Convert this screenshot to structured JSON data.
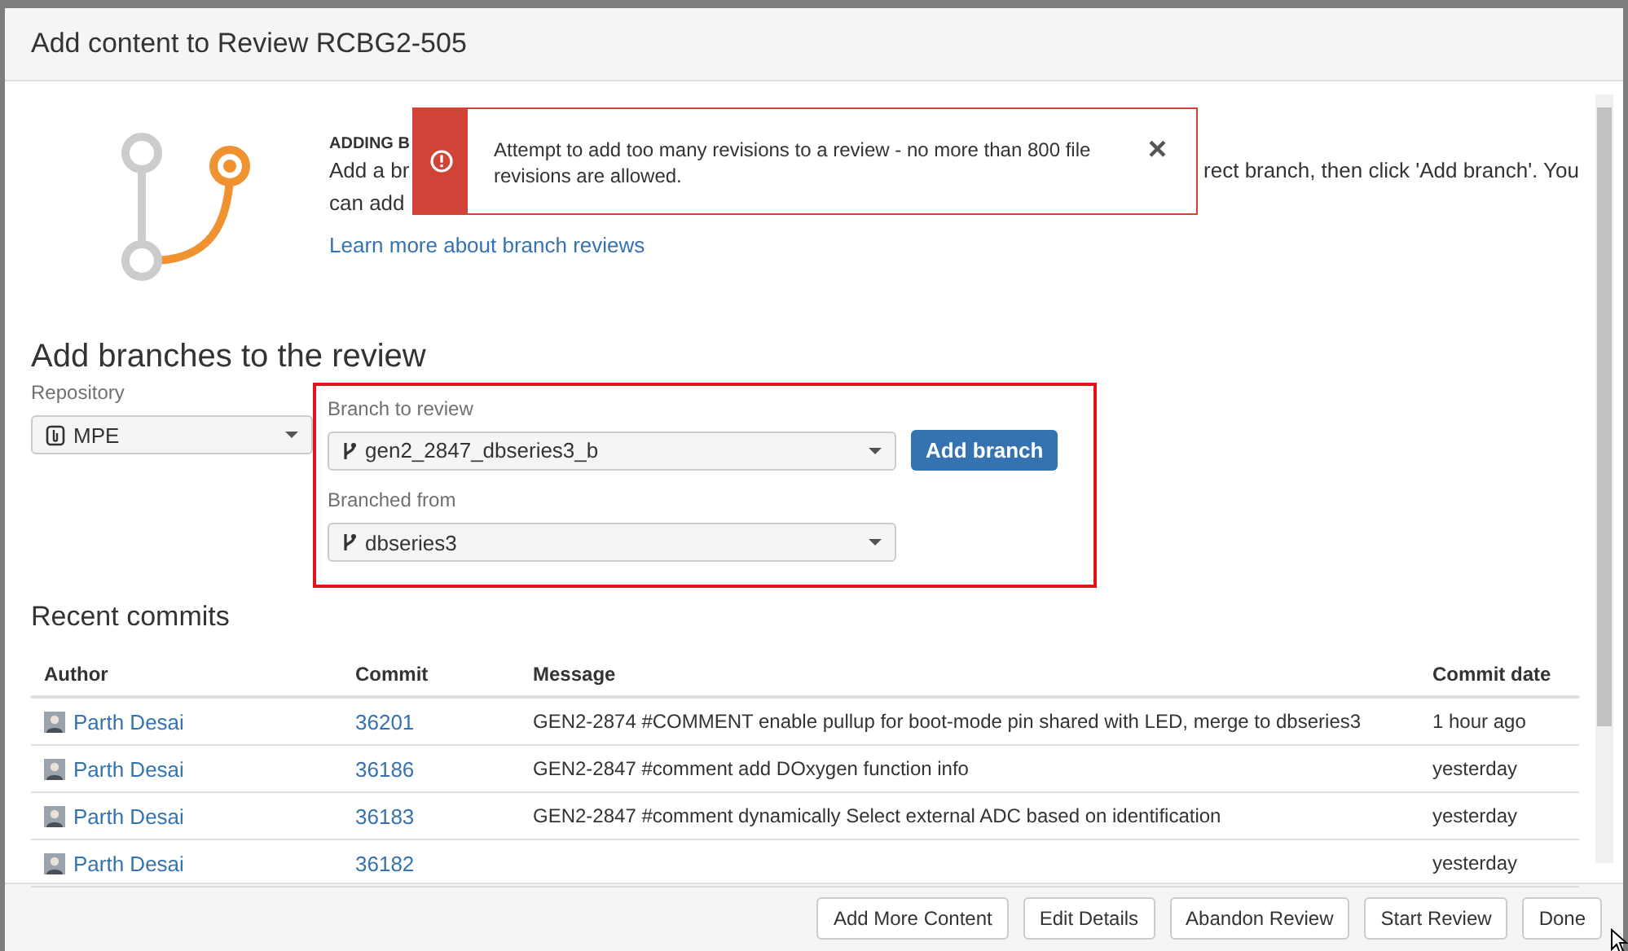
{
  "dialog": {
    "title": "Add content to Review RCBG2-505"
  },
  "intro": {
    "heading": "ADDING B",
    "line_1_start": "Add a br",
    "line_1_end": "rect branch, then click 'Add branch'. You",
    "line_2": "can add",
    "link": "Learn more about branch reviews"
  },
  "alert": {
    "message": "Attempt to add too many revisions to a review - no more than 800 file revisions are allowed.",
    "close": "×"
  },
  "form": {
    "title": "Add branches to the review",
    "repository": {
      "label": "Repository",
      "value": "MPE"
    },
    "branch": {
      "label": "Branch to review",
      "value": "gen2_2847_dbseries3_b"
    },
    "add_button": "Add branch",
    "branched_from": {
      "label": "Branched from",
      "value": "dbseries3"
    }
  },
  "commits": {
    "title": "Recent commits",
    "columns": [
      "Author",
      "Commit",
      "Message",
      "Commit date"
    ],
    "rows": [
      {
        "author": "Parth Desai",
        "commit": "36201",
        "message": "GEN2-2874 #COMMENT enable pullup for boot-mode pin shared with LED, merge to dbseries3",
        "date": "1 hour ago"
      },
      {
        "author": "Parth Desai",
        "commit": "36186",
        "message": "GEN2-2847 #comment add DOxygen function info",
        "date": "yesterday"
      },
      {
        "author": "Parth Desai",
        "commit": "36183",
        "message": "GEN2-2847 #comment dynamically Select external ADC based on identification",
        "date": "yesterday"
      },
      {
        "author": "Parth Desai",
        "commit": "36182",
        "date": "yesterday"
      }
    ]
  },
  "buttons": [
    "Add More Content",
    "Edit Details",
    "Abandon Review",
    "Start Review",
    "Done"
  ]
}
